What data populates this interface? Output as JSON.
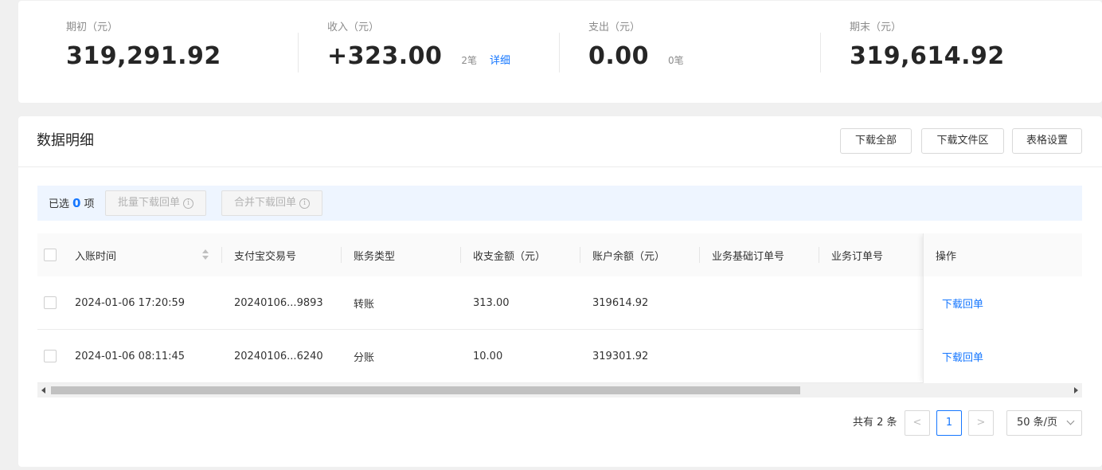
{
  "summary": {
    "opening": {
      "label": "期初（元）",
      "value": "319,291.92"
    },
    "income": {
      "label": "收入（元）",
      "value": "+323.00",
      "count": "2笔",
      "detail": "详细"
    },
    "expense": {
      "label": "支出（元）",
      "value": "0.00",
      "count": "0笔"
    },
    "closing": {
      "label": "期末（元）",
      "value": "319,614.92"
    }
  },
  "panel": {
    "title": "数据明细",
    "buttons": {
      "download_all": "下载全部",
      "download_area": "下载文件区",
      "table_settings": "表格设置"
    }
  },
  "selection": {
    "prefix": "已选",
    "count": "0",
    "suffix": "项",
    "batch_download": "批量下载回单",
    "merge_download": "合并下载回单",
    "info_glyph": "i"
  },
  "table": {
    "headers": [
      "入账时间",
      "支付宝交易号",
      "账务类型",
      "收支金额（元）",
      "账户余额（元）",
      "业务基础订单号",
      "业务订单号",
      "操作"
    ],
    "rows": [
      {
        "time": "2024-01-06 17:20:59",
        "trade_no": "20240106...9893",
        "type": "转账",
        "amount": "313.00",
        "balance": "319614.92",
        "base_order": "",
        "order": "",
        "action": "下载回单"
      },
      {
        "time": "2024-01-06 08:11:45",
        "trade_no": "20240106...6240",
        "type": "分账",
        "amount": "10.00",
        "balance": "319301.92",
        "base_order": "",
        "order": "",
        "action": "下载回单"
      }
    ]
  },
  "pagination": {
    "total": "共有 2 条",
    "prev": "<",
    "current": "1",
    "next": ">",
    "page_size": "50 条/页"
  },
  "colors": {
    "accent": "#1677ff",
    "selection_bg": "#eef5ff"
  }
}
